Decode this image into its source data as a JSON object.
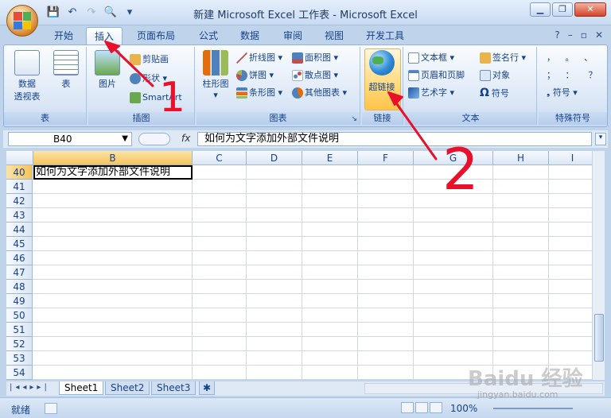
{
  "window": {
    "title": "新建 Microsoft Excel 工作表 - Microsoft Excel"
  },
  "ribbon_tabs": [
    "开始",
    "插入",
    "页面布局",
    "公式",
    "数据",
    "审阅",
    "视图",
    "开发工具"
  ],
  "active_tab": "插入",
  "groups": {
    "table": {
      "label": "表",
      "pivot": "数据\n透视表",
      "pivot_l1": "数据",
      "pivot_l2": "透视表",
      "table_btn": "表"
    },
    "illus": {
      "label": "插图",
      "picture": "图片",
      "clipart": "剪贴画",
      "shapes": "形状",
      "smartart": "SmartArt"
    },
    "charts": {
      "label": "图表",
      "column": "柱形图",
      "line": "折线图",
      "pie": "饼图",
      "bar": "条形图",
      "area": "面积图",
      "scatter": "散点图",
      "other": "其他图表"
    },
    "links": {
      "label": "链接",
      "hyperlink": "超链接"
    },
    "text": {
      "label": "文本",
      "textbox": "文本框",
      "header": "页眉和页脚",
      "wordart": "艺术字",
      "signature": "签名行",
      "object": "对象",
      "symbol": "符号"
    },
    "special": {
      "label": "特殊符号",
      "symbol": "符号"
    }
  },
  "formula_bar": {
    "name_box": "B40",
    "fx": "fx",
    "content": "如何为文字添加外部文件说明"
  },
  "columns": [
    "B",
    "C",
    "D",
    "E",
    "F",
    "G",
    "H",
    "I"
  ],
  "rows": [
    "40",
    "41",
    "42",
    "43",
    "44",
    "45",
    "46",
    "47",
    "48",
    "49",
    "50",
    "51",
    "52",
    "53",
    "54"
  ],
  "cell_b40": "如何为文字添加外部文件说明",
  "sheets": [
    "Sheet1",
    "Sheet2",
    "Sheet3"
  ],
  "status": {
    "ready": "就绪",
    "zoom": "100%"
  },
  "watermark": {
    "brand": "Baidu 经验",
    "url": "jingyan.baidu.com"
  },
  "annotations": {
    "one": "1",
    "two": "2"
  },
  "colors": {
    "accent": "#15428b",
    "annotation": "#e8102a"
  }
}
